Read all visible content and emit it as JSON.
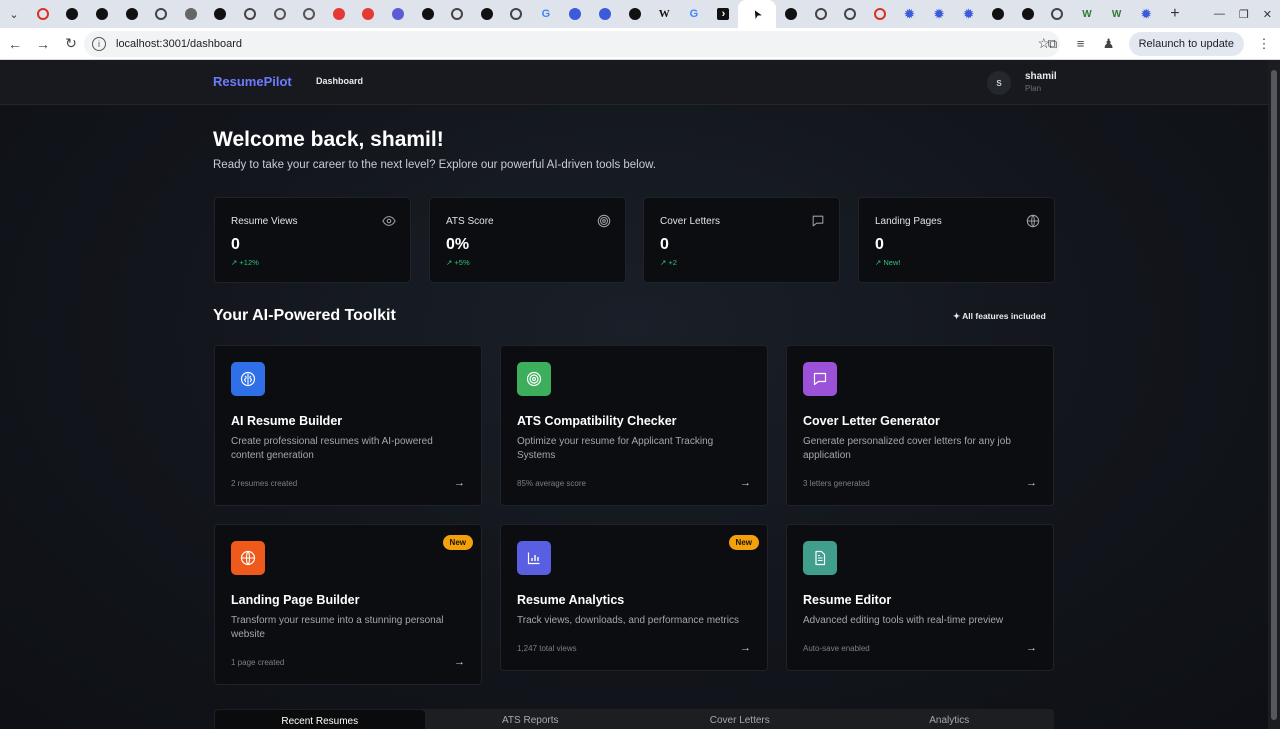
{
  "browser": {
    "url": "localhost:3001/dashboard",
    "relaunch_label": "Relaunch to update",
    "tabs": [
      {
        "icon": "red-circle",
        "color": "#d93025"
      },
      {
        "icon": "openai-icon",
        "color": "#111111"
      },
      {
        "icon": "github-icon",
        "color": "#111111"
      },
      {
        "icon": "github-icon",
        "color": "#111111"
      },
      {
        "icon": "globe-icon",
        "color": "#444444"
      },
      {
        "icon": "antenna-icon",
        "color": "#666666"
      },
      {
        "icon": "github-icon",
        "color": "#111111"
      },
      {
        "icon": "globe-icon",
        "color": "#444444"
      },
      {
        "icon": "globe-icon",
        "color": "#555555"
      },
      {
        "icon": "globe-icon",
        "color": "#555555"
      },
      {
        "icon": "red-app-icon",
        "color": "#e53935"
      },
      {
        "icon": "red-slash-icon",
        "color": "#e53935"
      },
      {
        "icon": "purple-circle-icon",
        "color": "#5b5bd6"
      },
      {
        "icon": "openai-icon",
        "color": "#111111"
      },
      {
        "icon": "globe-icon",
        "color": "#444444"
      },
      {
        "icon": "openai-icon",
        "color": "#111111"
      },
      {
        "icon": "globe-icon",
        "color": "#444444"
      },
      {
        "icon": "google-icon",
        "color": "#4285f4"
      },
      {
        "icon": "bird-icon",
        "color": "#3b5bdb"
      },
      {
        "icon": "bird-icon",
        "color": "#3b5bdb"
      },
      {
        "icon": "openai-icon",
        "color": "#111111"
      },
      {
        "icon": "wikipedia-icon",
        "color": "#111111"
      },
      {
        "icon": "google-icon",
        "color": "#4285f4"
      },
      {
        "icon": "arrow-app-icon",
        "color": "#111111"
      },
      {
        "icon": "cursor-icon",
        "color": "#111111",
        "active": true
      },
      {
        "icon": "openai-icon",
        "color": "#111111"
      },
      {
        "icon": "globe-icon",
        "color": "#444444"
      },
      {
        "icon": "globe-icon",
        "color": "#444444"
      },
      {
        "icon": "red-circle",
        "color": "#d93025"
      },
      {
        "icon": "gear-icon",
        "color": "#3b5bdb"
      },
      {
        "icon": "gear-icon",
        "color": "#3b5bdb"
      },
      {
        "icon": "gear-icon",
        "color": "#3b5bdb"
      },
      {
        "icon": "openai-icon",
        "color": "#111111"
      },
      {
        "icon": "openai-icon",
        "color": "#111111"
      },
      {
        "icon": "globe-icon",
        "color": "#444444"
      },
      {
        "icon": "w-icon",
        "color": "#2e7d32"
      },
      {
        "icon": "w-icon",
        "color": "#2e7d32"
      },
      {
        "icon": "gear-icon",
        "color": "#3b5bdb"
      }
    ]
  },
  "nav": {
    "brand": "ResumePilot",
    "link": "Dashboard",
    "user_initial": "S",
    "user_name": "shamil",
    "user_plan": "Plan"
  },
  "hero": {
    "title": "Welcome back, shamil!",
    "subtitle": "Ready to take your career to the next level? Explore our powerful AI-driven tools below."
  },
  "stats": [
    {
      "label": "Resume Views",
      "value": "0",
      "delta": "+12%",
      "icon": "eye-icon"
    },
    {
      "label": "ATS Score",
      "value": "0%",
      "delta": "+5%",
      "icon": "target-icon"
    },
    {
      "label": "Cover Letters",
      "value": "0",
      "delta": "+2",
      "icon": "message-icon"
    },
    {
      "label": "Landing Pages",
      "value": "0",
      "delta": "New!",
      "icon": "globe-icon"
    }
  ],
  "toolkit": {
    "title": "Your AI-Powered Toolkit",
    "badge": "All features included",
    "cards": [
      {
        "title": "AI Resume Builder",
        "desc": "Create professional resumes with AI-powered content generation",
        "meta": "2 resumes created",
        "icon": "brain-icon",
        "color": "#2f6fe8",
        "badge": ""
      },
      {
        "title": "ATS Compatibility Checker",
        "desc": "Optimize your resume for Applicant Tracking Systems",
        "meta": "85% average score",
        "icon": "target-icon",
        "color": "#3cae5c",
        "badge": ""
      },
      {
        "title": "Cover Letter Generator",
        "desc": "Generate personalized cover letters for any job application",
        "meta": "3 letters generated",
        "icon": "message-icon",
        "color": "#9b52d9",
        "badge": ""
      },
      {
        "title": "Landing Page Builder",
        "desc": "Transform your resume into a stunning personal website",
        "meta": "1 page created",
        "icon": "globe-icon",
        "color": "#ef5a1c",
        "badge": "New"
      },
      {
        "title": "Resume Analytics",
        "desc": "Track views, downloads, and performance metrics",
        "meta": "1,247 total views",
        "icon": "bar-chart-icon",
        "color": "#5a5ee0",
        "badge": "New"
      },
      {
        "title": "Resume Editor",
        "desc": "Advanced editing tools with real-time preview",
        "meta": "Auto-save enabled",
        "icon": "file-icon",
        "color": "#3f9e8c",
        "badge": ""
      }
    ]
  },
  "bottom_tabs": [
    "Recent Resumes",
    "ATS Reports",
    "Cover Letters",
    "Analytics"
  ]
}
